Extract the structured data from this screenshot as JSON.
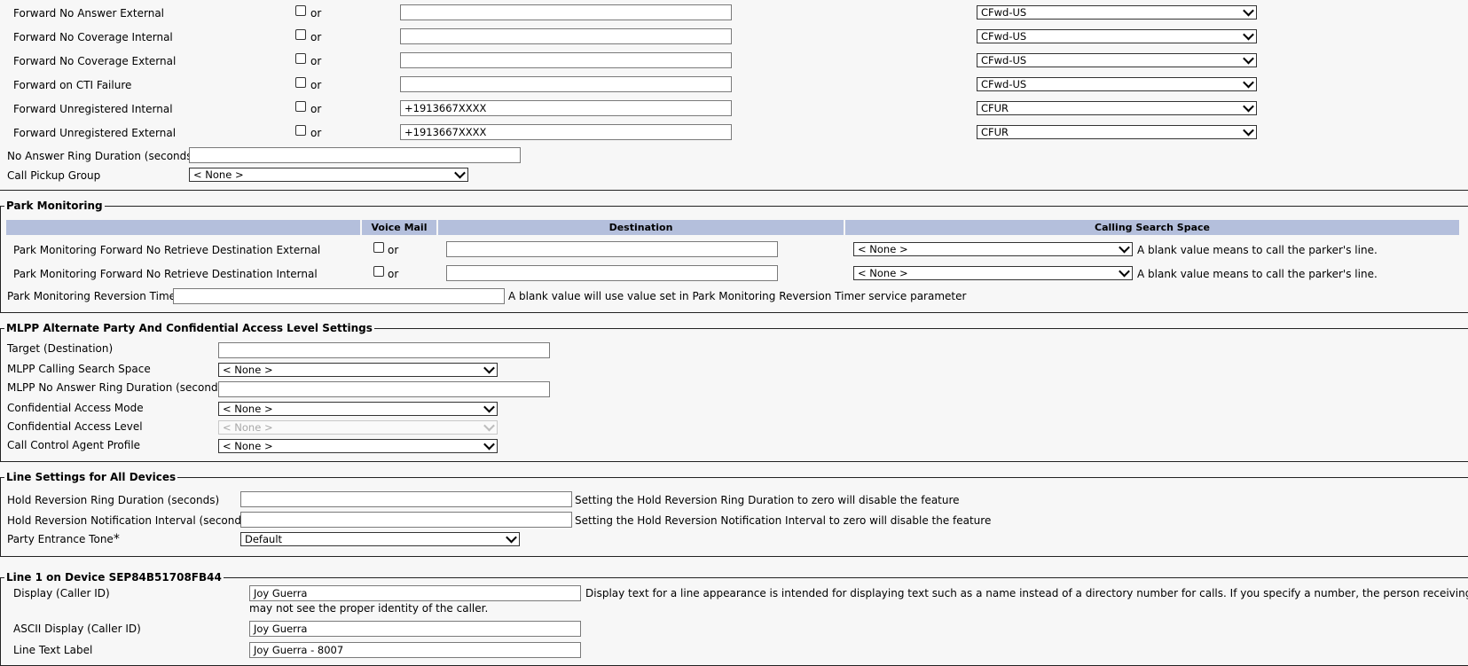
{
  "forward": {
    "or_text": "or",
    "rows": [
      {
        "label": "Forward No Answer External",
        "value": "",
        "css": "CFwd-US"
      },
      {
        "label": "Forward No Coverage Internal",
        "value": "",
        "css": "CFwd-US"
      },
      {
        "label": "Forward No Coverage External",
        "value": "",
        "css": "CFwd-US"
      },
      {
        "label": "Forward on CTI Failure",
        "value": "",
        "css": "CFwd-US"
      },
      {
        "label": "Forward Unregistered Internal",
        "value": "+1913667XXXX",
        "css": "CFUR"
      },
      {
        "label": "Forward Unregistered External",
        "value": "+1913667XXXX",
        "css": "CFUR"
      }
    ],
    "no_answer_ring_label": "No Answer Ring Duration (seconds)",
    "no_answer_ring_value": "",
    "call_pickup_label": "Call Pickup Group",
    "call_pickup_value": "< None >"
  },
  "park": {
    "legend": "Park Monitoring",
    "headers": {
      "voice_mail": "Voice Mail",
      "destination": "Destination",
      "css": "Calling Search Space"
    },
    "rows": [
      {
        "label": "Park Monitoring Forward No Retrieve Destination External",
        "css": "< None >",
        "note": "A blank value means to call the parker's line."
      },
      {
        "label": "Park Monitoring Forward No Retrieve Destination Internal",
        "css": "< None >",
        "note": "A blank value means to call the parker's line."
      }
    ],
    "timer_label": "Park Monitoring Reversion Timer",
    "timer_note": "A blank value will use value set in Park Monitoring Reversion Timer service parameter"
  },
  "mlpp": {
    "legend": "MLPP Alternate Party And Confidential Access Level Settings",
    "target_label": "Target (Destination)",
    "css_label": "MLPP Calling Search Space",
    "css_value": "< None >",
    "ring_label": "MLPP No Answer Ring Duration (seconds)",
    "cam_label": "Confidential Access Mode",
    "cam_value": "< None >",
    "cal_label": "Confidential Access Level",
    "cal_value": "< None >",
    "ccap_label": "Call Control Agent Profile",
    "ccap_value": "< None >"
  },
  "line_settings": {
    "legend": "Line Settings for All Devices",
    "hold_ring_label": "Hold Reversion Ring Duration (seconds)",
    "hold_ring_note": "Setting the Hold Reversion Ring Duration to zero will disable the feature",
    "hold_notif_label": "Hold Reversion Notification Interval (seconds)",
    "hold_notif_note": "Setting the Hold Reversion Notification Interval to zero will disable the feature",
    "tone_label": "Party Entrance Tone",
    "tone_req": "*",
    "tone_value": "Default"
  },
  "line1": {
    "legend": "Line 1 on Device SEP84B51708FB44",
    "display_label": "Display (Caller ID)",
    "display_value": "Joy Guerra",
    "display_note_1": "Display text for a line appearance is intended for displaying text such as a name instead of a directory number for calls. If you specify a number, the person receiving a call",
    "display_note_2": "may not see the proper identity of the caller.",
    "ascii_label": "ASCII Display (Caller ID)",
    "ascii_value": "Joy Guerra",
    "text_label": "Line Text Label",
    "text_value": "Joy Guerra - 8007"
  }
}
